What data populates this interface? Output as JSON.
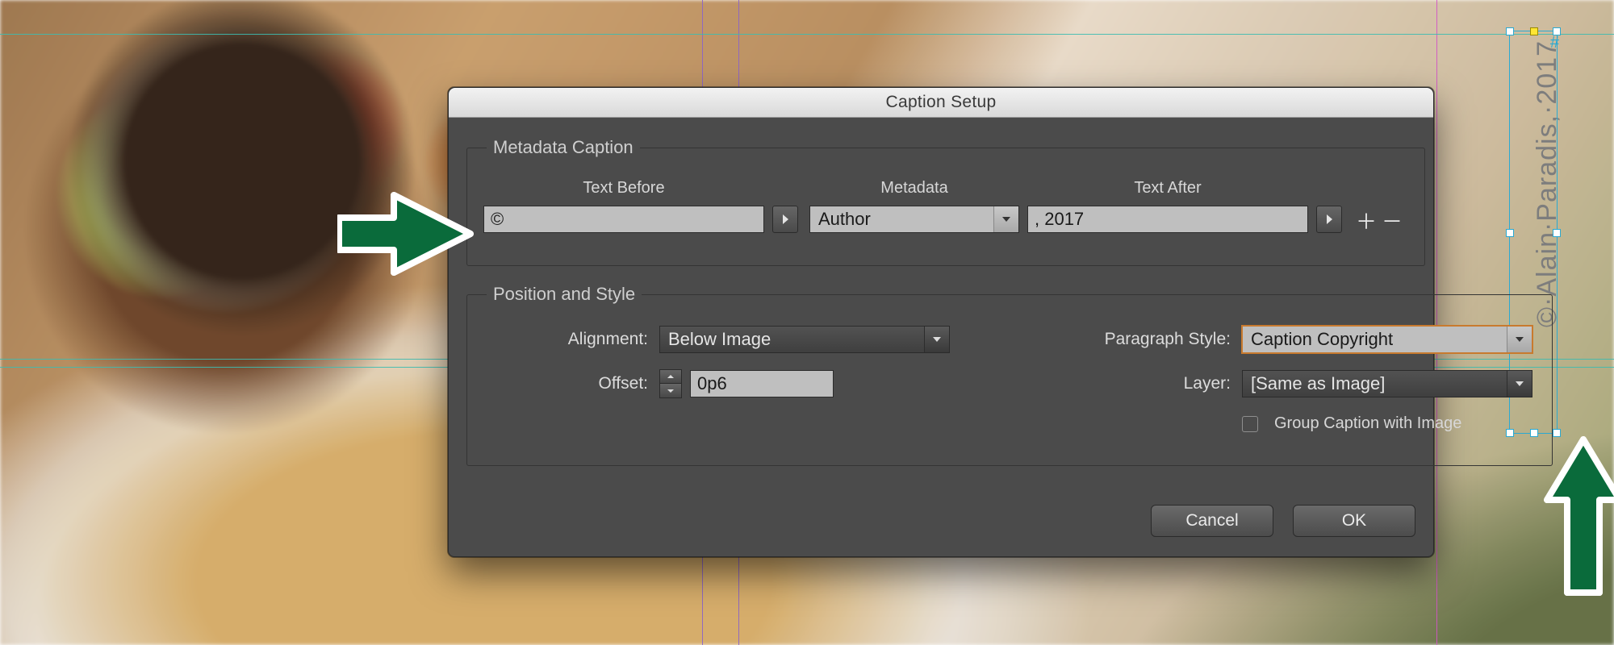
{
  "dialog": {
    "title": "Caption Setup",
    "metadata_legend": "Metadata Caption",
    "position_legend": "Position and Style",
    "columns": {
      "text_before": "Text Before",
      "metadata": "Metadata",
      "text_after": "Text After"
    },
    "text_before_value": "©",
    "metadata_value": "Author",
    "text_after_value": ", 2017",
    "labels": {
      "alignment": "Alignment:",
      "offset": "Offset:",
      "paragraph_style": "Paragraph Style:",
      "layer": "Layer:",
      "group": "Group Caption with Image"
    },
    "alignment_value": "Below Image",
    "offset_value": "0p6",
    "paragraph_style_value": "Caption Copyright",
    "layer_value": "[Same as Image]",
    "buttons": {
      "cancel": "Cancel",
      "ok": "OK"
    }
  },
  "caption_preview": "©·Alain·Paradis,·2017"
}
